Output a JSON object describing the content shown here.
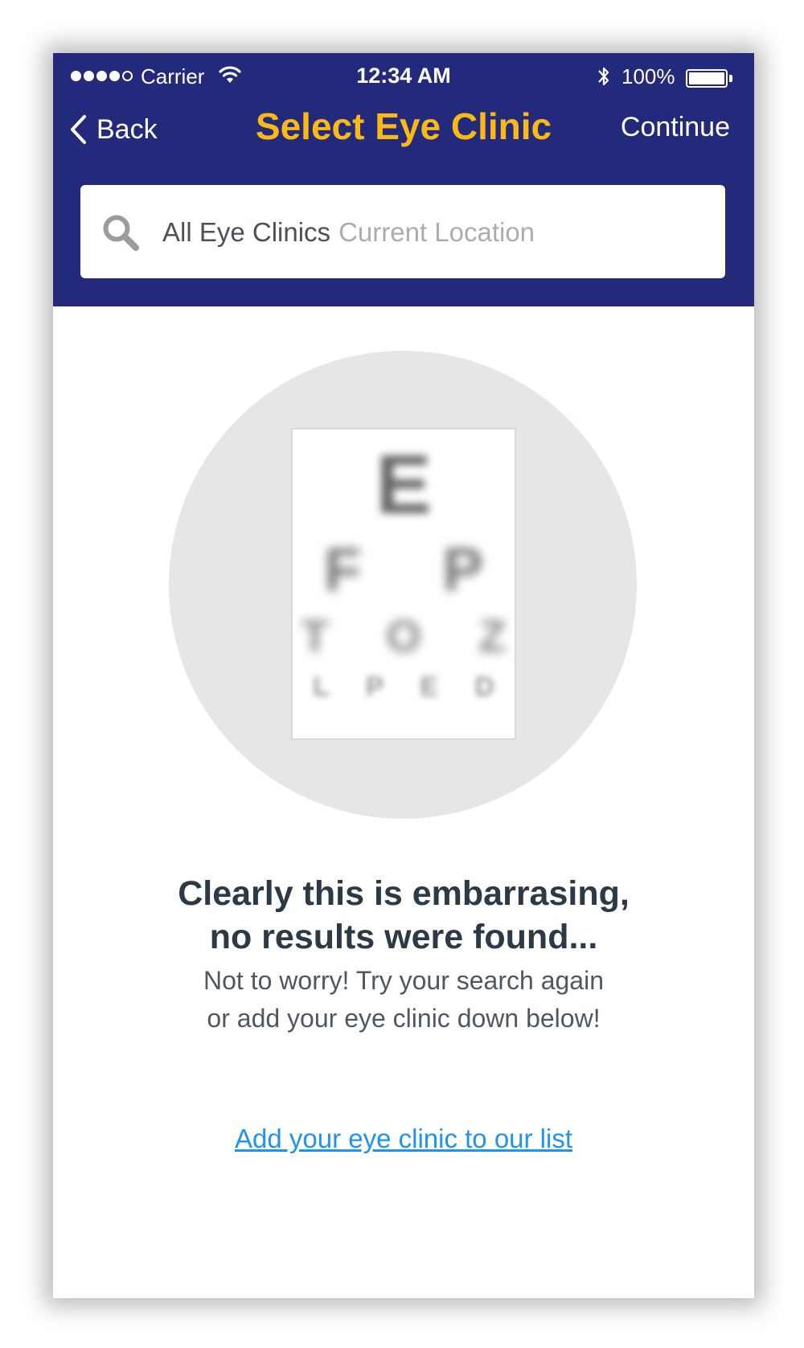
{
  "status_bar": {
    "carrier": "Carrier",
    "time": "12:34 AM",
    "battery": "100%",
    "signal_bars_filled": 4,
    "signal_bars_total": 5
  },
  "nav": {
    "back_label": "Back",
    "title": "Select Eye Clinic",
    "continue_label": "Continue"
  },
  "search": {
    "scope": "All Eye Clinics",
    "location": "Current Location",
    "icon": "search-icon"
  },
  "illustration": {
    "rows": [
      "E",
      "F P",
      "T O Z",
      "L P E D"
    ]
  },
  "empty_state": {
    "headline_line1": "Clearly this is embarrasing,",
    "headline_line2": "no results were found...",
    "subtext_line1": "Not to worry! Try your search again",
    "subtext_line2": "or add your eye clinic down below!",
    "add_link": "Add your eye clinic to our list"
  },
  "colors": {
    "header_bg": "#232a7c",
    "title": "#fcb913",
    "link": "#1f93f0",
    "headline": "#2c3a47"
  }
}
